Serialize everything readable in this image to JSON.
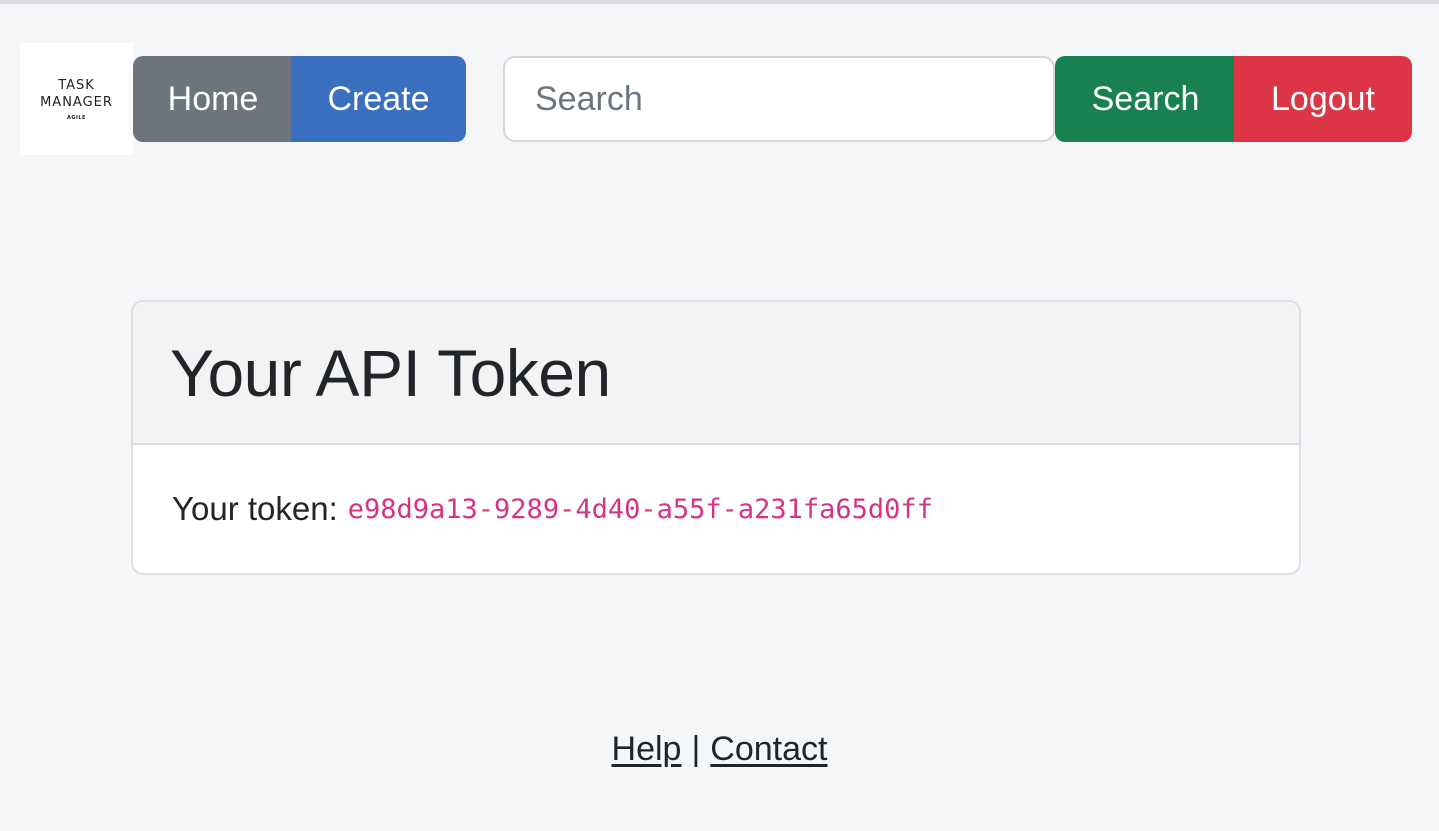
{
  "navbar": {
    "logo": {
      "line1": "TASK",
      "line2": "MANAGER",
      "tagline": "AGILE"
    },
    "home_label": "Home",
    "create_label": "Create",
    "search_placeholder": "Search",
    "search_button_label": "Search",
    "logout_label": "Logout"
  },
  "card": {
    "title": "Your API Token",
    "token_label": "Your token:",
    "token_value": "e98d9a13-9289-4d40-a55f-a231fa65d0ff"
  },
  "footer": {
    "help_label": "Help",
    "separator": "|",
    "contact_label": "Contact"
  },
  "colors": {
    "home_button": "#6c757d",
    "create_button": "#3a6ebf",
    "search_button": "#19814f",
    "logout_button": "#dc3545",
    "token_text": "#d63384"
  }
}
